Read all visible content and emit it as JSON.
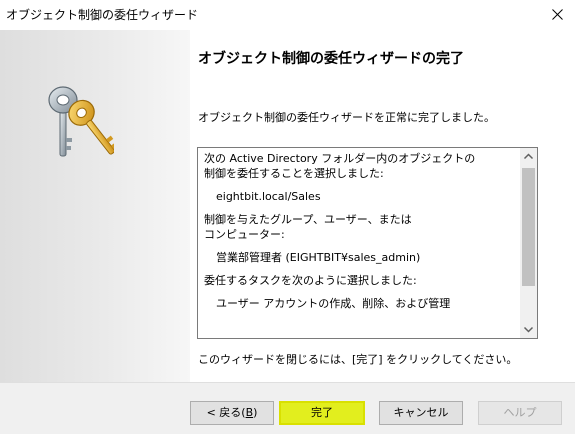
{
  "window": {
    "title": "オブジェクト制御の委任ウィザード"
  },
  "page": {
    "heading": "オブジェクト制御の委任ウィザードの完了",
    "intro": "オブジェクト制御の委任ウィザードを正常に完了しました。",
    "summary_lines": [
      "次の Active Directory フォルダー内のオブジェクトの",
      "制御を委任することを選択しました:",
      "eightbit.local/Sales",
      "制御を与えたグループ、ユーザー、または",
      "コンピューター:",
      "営業部管理者 (EIGHTBIT¥sales_admin)",
      "委任するタスクを次のように選択しました:",
      "ユーザー アカウントの作成、削除、および管理"
    ],
    "footer": "このウィザードを閉じるには、[完了] をクリックしてください。"
  },
  "buttons": {
    "back_prefix": "< 戻る(",
    "back_key": "B",
    "back_suffix": ")",
    "finish": "完了",
    "cancel": "キャンセル",
    "help": "ヘルプ"
  },
  "icons": {
    "close": "close-icon",
    "keys": "keys-icon",
    "scroll_up": "chevron-up-icon",
    "scroll_down": "chevron-down-icon"
  },
  "colors": {
    "finish_highlight": "#e2ee1e"
  }
}
